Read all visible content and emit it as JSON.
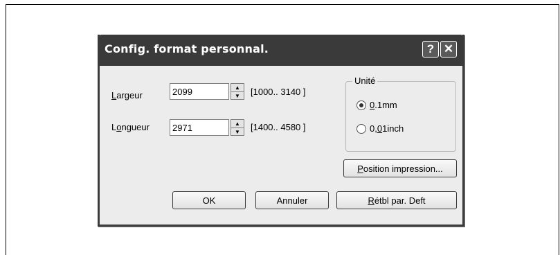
{
  "dialog": {
    "title": "Config. format personnal.",
    "help_glyph": "?",
    "close_glyph": "✕"
  },
  "width": {
    "label_first": "L",
    "label_rest": "argeur",
    "value": "2099",
    "range": "[1000.. 3140 ]"
  },
  "length": {
    "label_first": "L",
    "label_mid": "o",
    "label_rest": "ngueur",
    "value": "2971",
    "range": "[1400.. 4580 ]"
  },
  "unit": {
    "title": "Unité",
    "options": [
      {
        "ul": "0",
        "rest": ".1mm",
        "selected": true
      },
      {
        "ul": "0",
        "mid": ",",
        "ul2": "0",
        "rest": "1inch",
        "selected": false
      }
    ]
  },
  "buttons": {
    "position_ul": "P",
    "position_rest": "osition impression...",
    "ok": "OK",
    "cancel": "Annuler",
    "reset_ul": "R",
    "reset_rest": "étbl par. Deft"
  },
  "icons": {
    "spin_up": "up-arrow-icon",
    "spin_down": "down-arrow-icon",
    "help": "help-icon",
    "close": "close-icon"
  }
}
